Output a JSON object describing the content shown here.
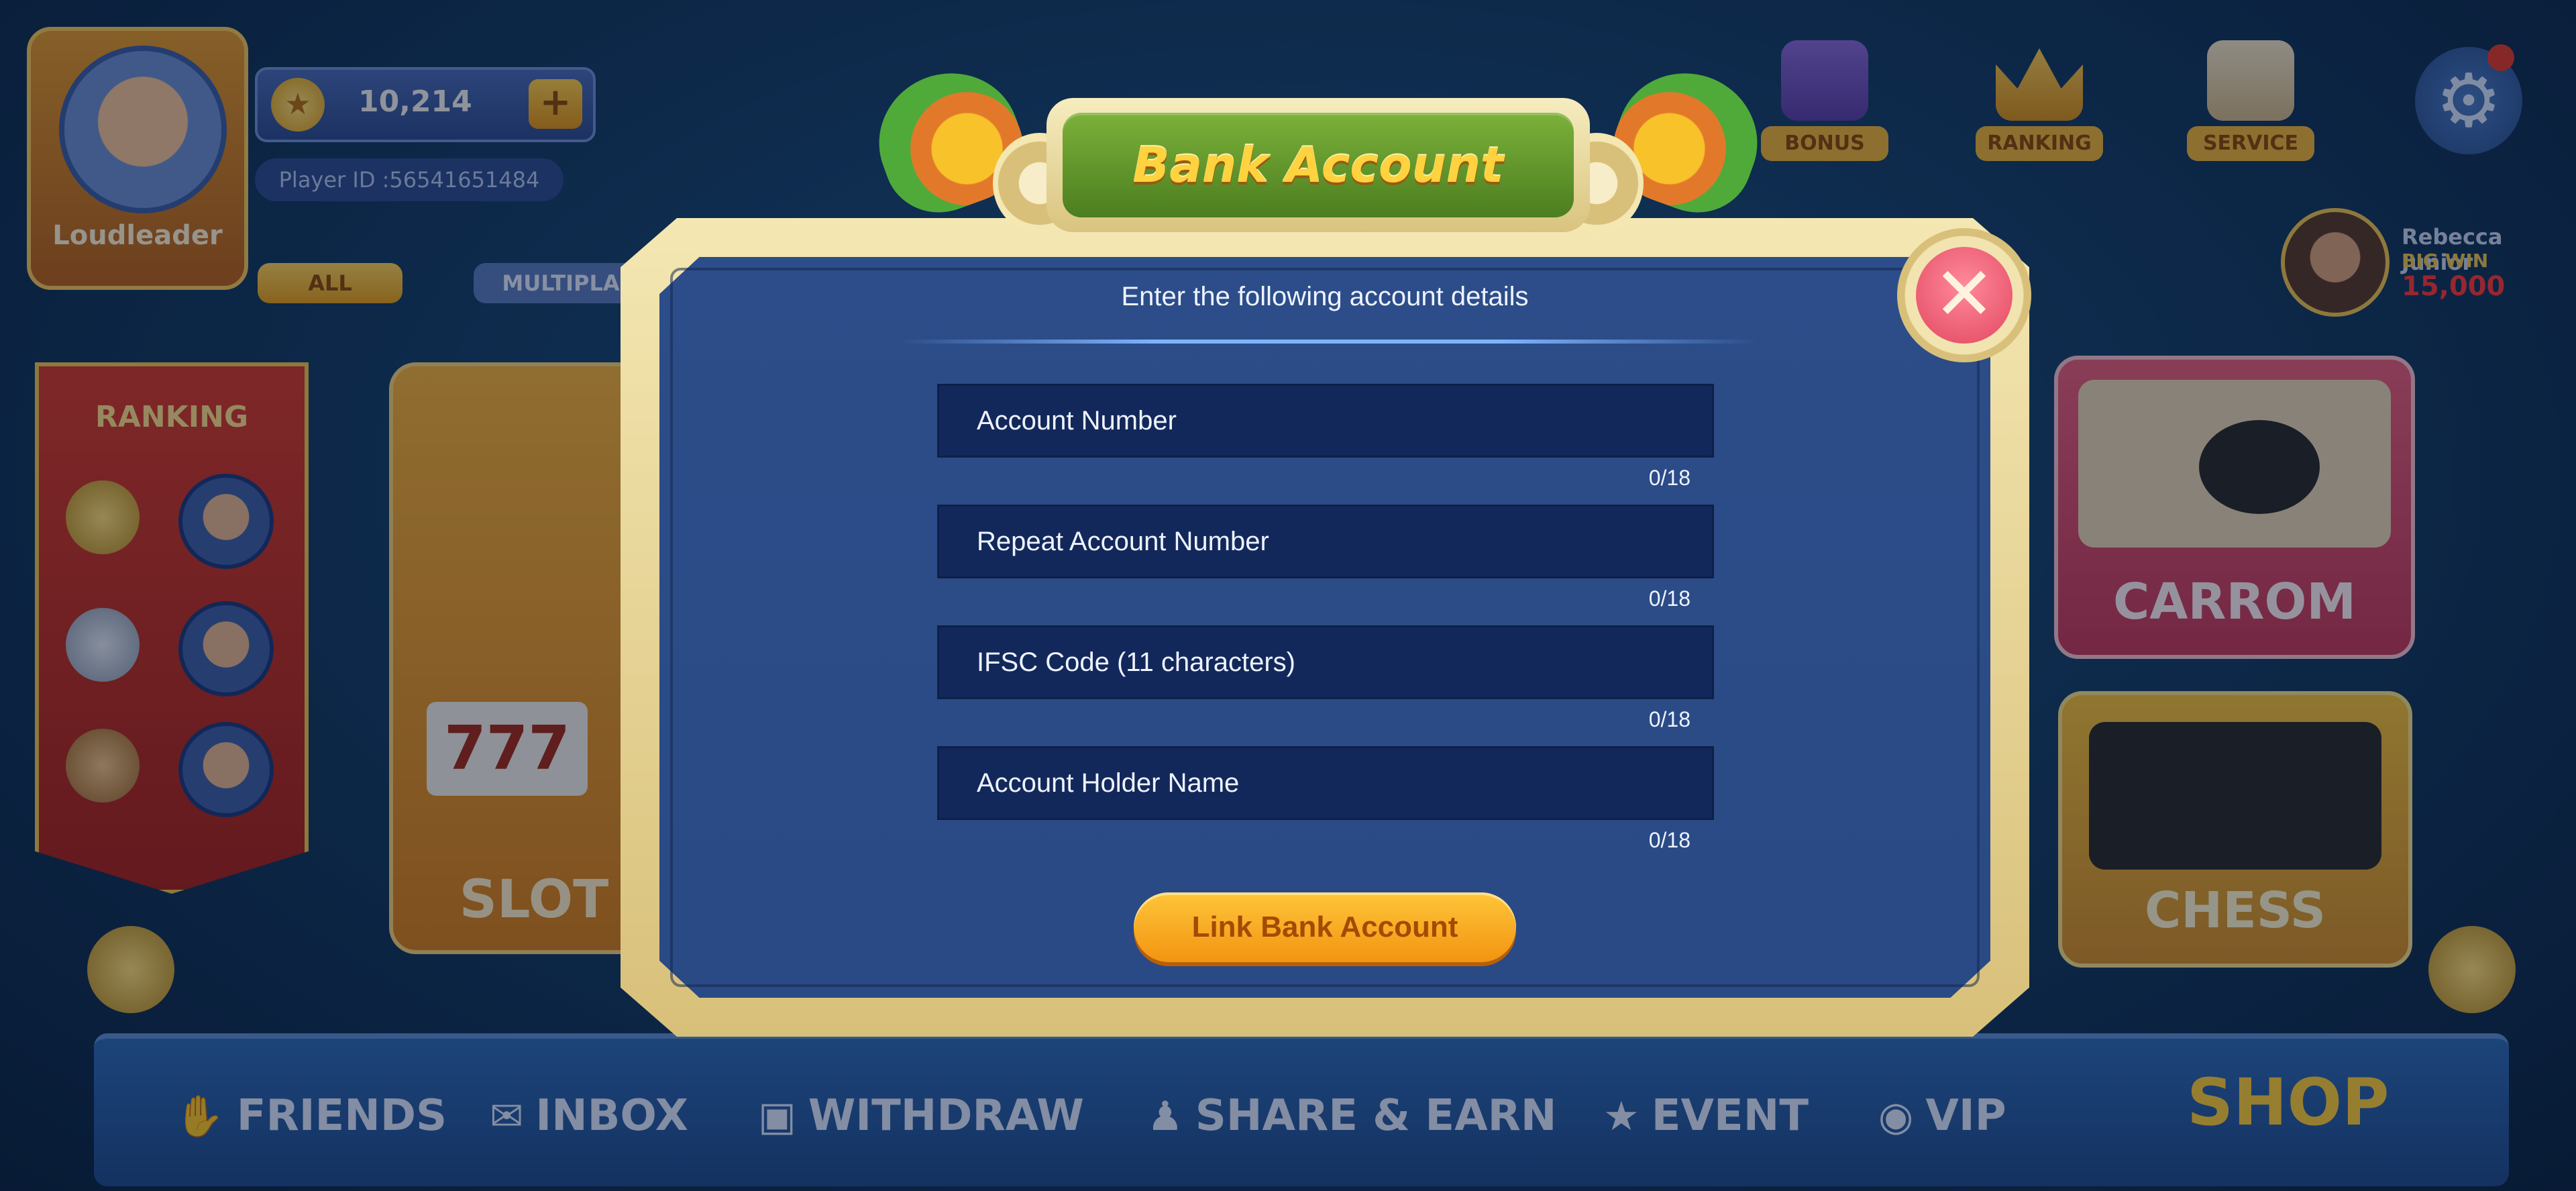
{
  "profile": {
    "name": "Loudleader",
    "coins": "10,214",
    "coin_plus": "+",
    "player_id": "Player ID :56541651484"
  },
  "filters": {
    "all": "ALL",
    "multiplayer": "MULTIPLA"
  },
  "ranking": {
    "title": "RANKING"
  },
  "top_icons": [
    {
      "label": "BONUS",
      "icon": "gift-icon"
    },
    {
      "label": "RANKING",
      "icon": "crown-icon"
    },
    {
      "label": "SERVICE",
      "icon": "pencil-icon"
    }
  ],
  "big_win": {
    "name": "Rebecca Junior",
    "label": "BIG WIN",
    "amount": "15,000"
  },
  "games": {
    "slot": "SLOT",
    "slot_reels": "777",
    "carrom": "CARROM",
    "chess": "CHESS"
  },
  "bottom_nav": [
    {
      "label": "FRIENDS",
      "icon": "handshake-icon"
    },
    {
      "label": "INBOX",
      "icon": "envelope-icon"
    },
    {
      "label": "WITHDRAW",
      "icon": "wallet-icon"
    },
    {
      "label": "SHARE & EARN",
      "icon": "people-icon"
    },
    {
      "label": "EVENT",
      "icon": "star-icon"
    },
    {
      "label": "VIP",
      "icon": "vip-badge-icon"
    },
    {
      "label": "SHOP",
      "icon": ""
    }
  ],
  "modal": {
    "title": "Bank Account",
    "subtitle": "Enter the following account details",
    "fields": [
      {
        "placeholder": "Account Number",
        "value": "",
        "counter": "0/18"
      },
      {
        "placeholder": "Repeat Account Number",
        "value": "",
        "counter": "0/18"
      },
      {
        "placeholder": "IFSC Code (11 characters)",
        "value": "",
        "counter": "0/18"
      },
      {
        "placeholder": "Account Holder Name",
        "value": "",
        "counter": "0/18"
      }
    ],
    "submit_label": "Link Bank Account",
    "close_glyph": "✕"
  },
  "colors": {
    "modal_bg": "#2c4d89",
    "field_bg": "#13285a",
    "frame": "#f4e7b2",
    "title_plate": "#5f9a2a",
    "title_text": "#ffd23f",
    "button": "#f6a21b",
    "close": "#e24761"
  }
}
